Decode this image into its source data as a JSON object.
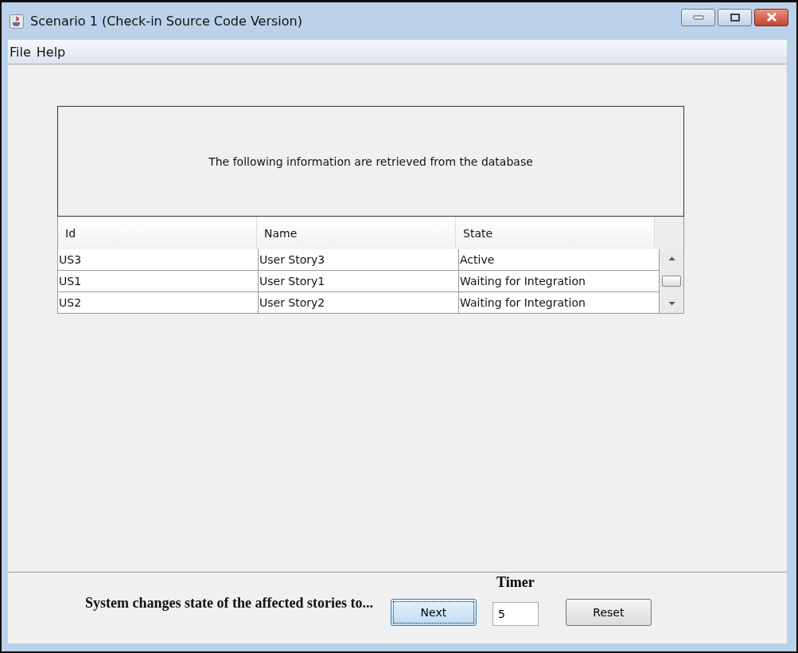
{
  "window": {
    "title": "Scenario 1 (Check-in Source Code Version)"
  },
  "menu": [
    "File",
    "Help"
  ],
  "info_panel": {
    "text": "The following information are retrieved from the database"
  },
  "table": {
    "columns": [
      "Id",
      "Name",
      "State"
    ],
    "rows": [
      [
        "US3",
        "User Story3",
        "Active"
      ],
      [
        "US1",
        "User Story1",
        "Waiting for Integration"
      ],
      [
        "US2",
        "User Story2",
        "Waiting for Integration"
      ]
    ]
  },
  "status_text": "System changes state of the affected stories to...",
  "timer": {
    "label": "Timer",
    "value": "5"
  },
  "buttons": [
    {
      "label": "Next",
      "focused": true
    },
    {
      "label": "Reset",
      "focused": false
    }
  ]
}
